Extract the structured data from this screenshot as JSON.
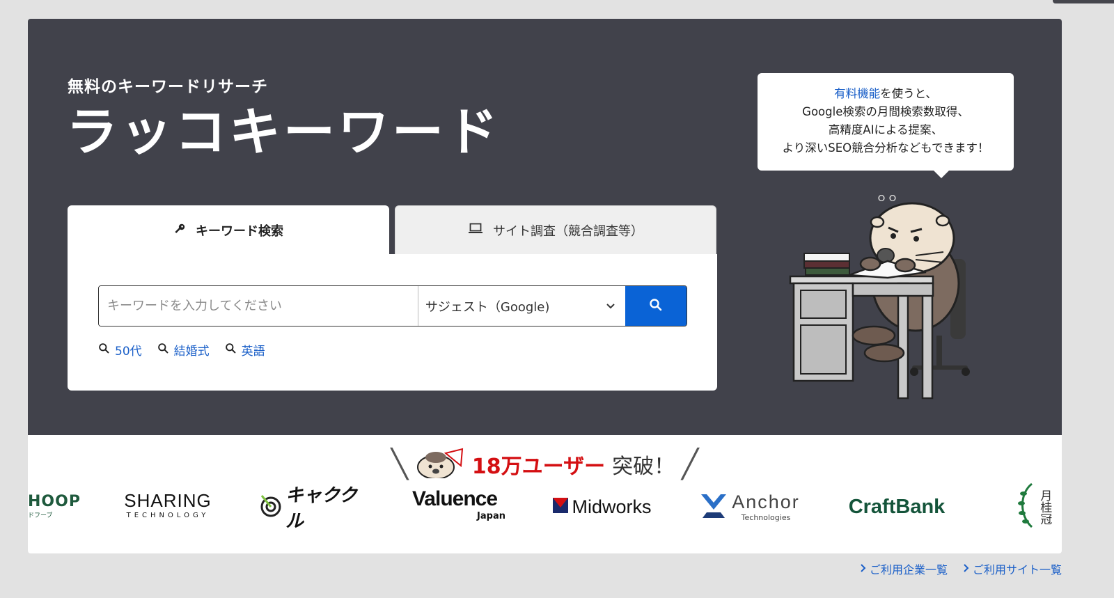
{
  "hero": {
    "subtitle": "無料のキーワードリサーチ",
    "title": "ラッコキーワード"
  },
  "tabs": [
    {
      "label": "キーワード検索",
      "icon": "key-icon",
      "active": true
    },
    {
      "label": "サイト調査（競合調査等）",
      "icon": "laptop-icon",
      "active": false
    }
  ],
  "search": {
    "placeholder": "キーワードを入力してください",
    "value": "",
    "mode_selected": "サジェスト（Google)",
    "button_icon": "search-icon"
  },
  "suggestions": [
    {
      "label": "50代"
    },
    {
      "label": "結婚式"
    },
    {
      "label": "英語"
    }
  ],
  "bubble": {
    "link_text": "有料機能",
    "line1_rest": "を使うと、",
    "line2": "Google検索の月間検索数取得、",
    "line3": "高精度AIによる提案、",
    "line4": "より深いSEO競合分析などもできます！"
  },
  "users_banner": {
    "count_text": "18万ユーザー",
    "suffix": "突破！"
  },
  "logos": [
    {
      "name": "HOOP",
      "sub": "ドフーブ"
    },
    {
      "name": "SHARING",
      "sub": "TECHNOLOGY"
    },
    {
      "name": "キャククル"
    },
    {
      "name": "Valuence",
      "sub": "Japan"
    },
    {
      "name": "Midworks"
    },
    {
      "name": "Anchor",
      "sub": "Technologies"
    },
    {
      "name": "CraftBank"
    },
    {
      "name": "月桂冠"
    }
  ],
  "footer_links": [
    {
      "label": "ご利用企業一覧"
    },
    {
      "label": "ご利用サイト一覧"
    }
  ],
  "colors": {
    "hero_bg": "#41424b",
    "accent_blue": "#0a63d6",
    "link_blue": "#1a5fc8",
    "users_red": "#d40f12"
  }
}
